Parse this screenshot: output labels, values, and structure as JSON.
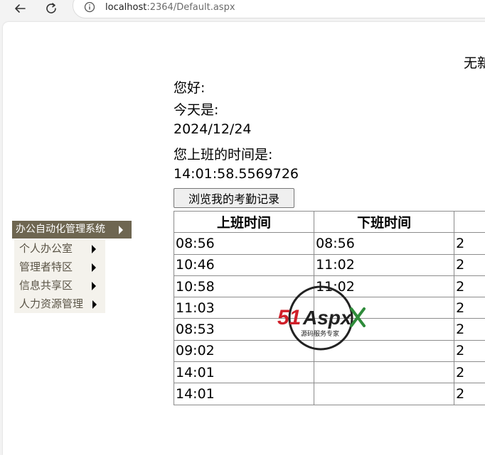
{
  "browser": {
    "url_host": "localhost",
    "url_rest": ":2364/Default.aspx"
  },
  "page": {
    "top_right_text": "无新",
    "greeting": "您好:",
    "today_label": "今天是:",
    "today_date": "2024/12/24",
    "clockin_label": "您上班的时间是:",
    "clockin_time": "14:01:58.5569726",
    "browse_button": "浏览我的考勤记录"
  },
  "menu": {
    "root": "办公自动化管理系统",
    "items": [
      {
        "label": "个人办公室"
      },
      {
        "label": "管理者特区"
      },
      {
        "label": "信息共享区"
      },
      {
        "label": "人力资源管理"
      }
    ]
  },
  "table": {
    "headers": [
      "上班时间",
      "下班时间",
      ""
    ],
    "rows": [
      [
        "08:56",
        "08:56",
        "2"
      ],
      [
        "10:46",
        "11:02",
        "2"
      ],
      [
        "10:58",
        "11:02",
        "2"
      ],
      [
        "11:03",
        "",
        "2"
      ],
      [
        "08:53",
        "",
        "2"
      ],
      [
        "09:02",
        "",
        "2"
      ],
      [
        "14:01",
        "",
        "2"
      ],
      [
        "14:01",
        "",
        "2"
      ]
    ]
  },
  "watermark": {
    "brand_num": "51",
    "brand_word": "Aspx",
    "tagline": "源码服务专家",
    "colors": {
      "red": "#d0202a",
      "green": "#2e8b3a"
    }
  },
  "icons": {
    "back": "back-arrow-icon",
    "reload": "reload-icon",
    "info": "info-icon",
    "menu_arrow": "triangle-right-icon"
  }
}
